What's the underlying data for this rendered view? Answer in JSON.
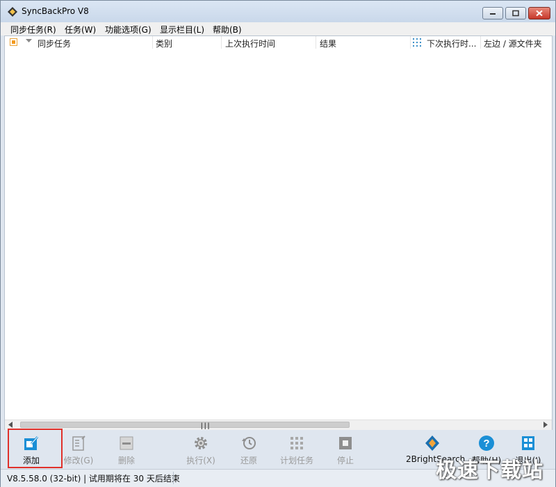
{
  "window": {
    "title": "SyncBackPro V8"
  },
  "menu": {
    "items": [
      "同步任务(R)",
      "任务(W)",
      "功能选项(G)",
      "显示栏目(L)",
      "帮助(B)"
    ]
  },
  "list": {
    "columns": [
      "同步任务",
      "类别",
      "上次执行时间",
      "结果",
      "下次执行时...",
      "左边 / 源文件夹"
    ]
  },
  "toolbar": {
    "add_label": "添加",
    "modify_label": "修改(G)",
    "delete_label": "删除",
    "run_label": "执行(X)",
    "restore_label": "还原",
    "schedule_label": "计划任务",
    "stop_label": "停止",
    "search_label": "2BrightSearch",
    "help_label": "帮助(H)",
    "exit_label": "退出(I)"
  },
  "status": {
    "text": "V8.5.58.0 (32-bit) | 试用期将在 30 天后结束"
  },
  "watermark": {
    "text": "极速下载站"
  },
  "colors": {
    "accent_blue": "#1a8fd6",
    "checkbox_orange": "#f39a1e",
    "highlight_red": "#e0302a"
  }
}
